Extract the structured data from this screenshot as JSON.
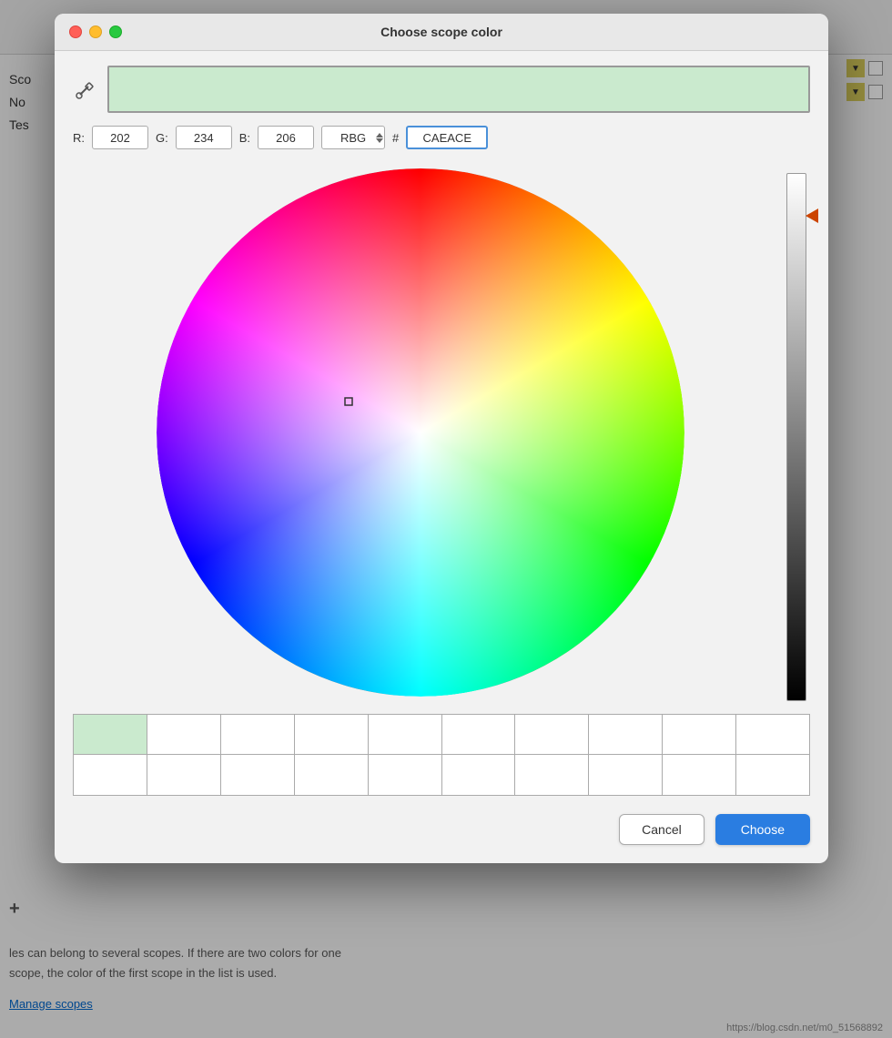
{
  "dialog": {
    "title": "Choose scope color",
    "traffic_lights": {
      "close": "close",
      "minimize": "minimize",
      "maximize": "maximize"
    },
    "color_preview": {
      "hex_value": "CAEACE",
      "background_color": "#CAEACE"
    },
    "rgb": {
      "r_label": "R:",
      "r_value": "202",
      "g_label": "G:",
      "g_value": "234",
      "b_label": "B:",
      "b_value": "206",
      "mode": "RBG",
      "hash_label": "#",
      "hex_value": "CAEACE"
    },
    "buttons": {
      "cancel_label": "Cancel",
      "choose_label": "Choose"
    }
  },
  "app": {
    "sidebar_texts": [
      "Sco",
      "No",
      "Tes"
    ],
    "bottom_text1": "les can belong to several scopes. If there are two colors for one",
    "bottom_text2": "scope, the color of the first scope in the list is used.",
    "bottom_link": "Manage scopes",
    "watermark": "https://blog.csdn.net/m0_51568892"
  }
}
